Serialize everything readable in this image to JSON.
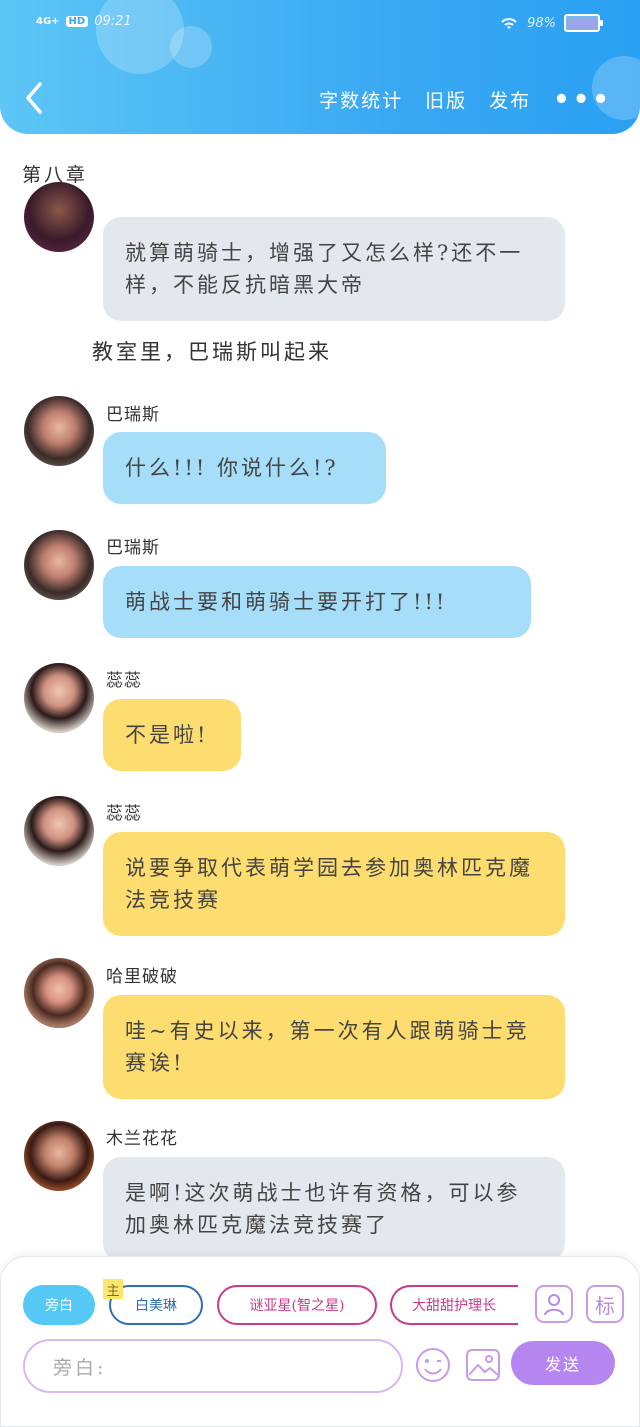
{
  "status_bar": {
    "network": "4G+",
    "hd": "HD",
    "time": "09:21",
    "battery": "98%",
    "battery_level": 0.98
  },
  "nav": {
    "back": "‹",
    "word_count": "字数统计",
    "old_version": "旧版",
    "publish": "发布",
    "more": "•••"
  },
  "chapter_title": "第八章",
  "messages": [
    {
      "name": "",
      "text": "就算萌骑士，增强了又怎么样?还不一样，不能反抗暗黑大帝",
      "color": "gray"
    },
    {
      "name": "巴瑞斯",
      "text": "什么!!! 你说什么!?",
      "color": "blue"
    },
    {
      "name": "巴瑞斯",
      "text": "萌战士要和萌骑士要开打了!!!",
      "color": "blue"
    },
    {
      "name": "蕊蕊",
      "text": "不是啦!",
      "color": "yellow"
    },
    {
      "name": "蕊蕊",
      "text": "说要争取代表萌学园去参加奥林匹克魔法竞技赛",
      "color": "yellow"
    },
    {
      "name": "哈里破破",
      "text": "哇~有史以来，第一次有人跟萌骑士竞赛诶!",
      "color": "yellow"
    },
    {
      "name": "木兰花花",
      "text": "是啊!这次萌战士也许有资格，可以参加奥林匹克魔法竞技赛了",
      "color": "gray"
    }
  ],
  "narration": "教室里，巴瑞斯叫起来",
  "bottom": {
    "roles": [
      "旁白",
      "白美琳",
      "谜亚星(智之星)",
      "大甜甜护理长"
    ],
    "main_tag": "主",
    "profile_icon": "person-card-icon",
    "tag_button": "标",
    "input_placeholder": "旁白:",
    "send": "发送"
  },
  "colors": {
    "header": "#3aa9f3",
    "blue_bubble": "#a6def9",
    "yellow_bubble": "#fddd6f",
    "gray_bubble": "#e3e8ef",
    "send": "#b586f0"
  }
}
